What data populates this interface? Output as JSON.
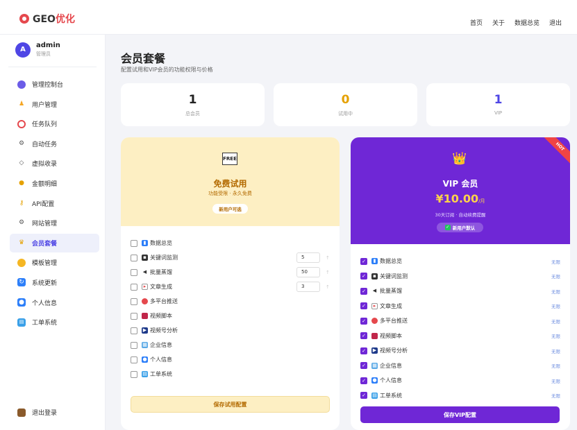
{
  "brand": {
    "logo_text": "GEO",
    "logo_accent": "优化",
    "accent_color": "#e5484d"
  },
  "topnav": {
    "home": "首页",
    "about": "关于",
    "overview": "数据总览",
    "exit": "退出"
  },
  "user": {
    "avatar_letter": "A",
    "name": "admin",
    "role": "管理员"
  },
  "sidebar": {
    "items": [
      {
        "label": "管理控制台",
        "icon": "console-icon"
      },
      {
        "label": "用户管理",
        "icon": "users-icon"
      },
      {
        "label": "任务队列",
        "icon": "queue-icon"
      },
      {
        "label": "自动任务",
        "icon": "auto-task-icon"
      },
      {
        "label": "虚拟收录",
        "icon": "tag-icon"
      },
      {
        "label": "金额明细",
        "icon": "money-icon"
      },
      {
        "label": "API配置",
        "icon": "key-icon"
      },
      {
        "label": "网站管理",
        "icon": "gear-icon"
      },
      {
        "label": "会员套餐",
        "icon": "crown-icon"
      },
      {
        "label": "模板管理",
        "icon": "palette-icon"
      },
      {
        "label": "系统更新",
        "icon": "refresh-icon"
      },
      {
        "label": "个人信息",
        "icon": "profile-icon"
      },
      {
        "label": "工单系统",
        "icon": "ticket-icon"
      }
    ],
    "logout": "退出登录"
  },
  "page": {
    "title": "会员套餐",
    "subtitle": "配置试用和VIP会员的功能权限与价格"
  },
  "stats": [
    {
      "value": "1",
      "label": "总会员",
      "color": "#222222"
    },
    {
      "value": "0",
      "label": "试用中",
      "color": "#e5a100"
    },
    {
      "value": "1",
      "label": "VIP",
      "color": "#4f46e5"
    }
  ],
  "free_plan": {
    "badge": "FREE",
    "title": "免费试用",
    "subtitle": "功能受限 · 永久免费",
    "pill": "新用户可选",
    "features": [
      {
        "label": "数据总览",
        "icon": "chart-icon",
        "checked": false
      },
      {
        "label": "关键词监测",
        "icon": "monitor-icon",
        "checked": false,
        "quota": "5"
      },
      {
        "label": "批量蒸馏",
        "icon": "speaker-icon",
        "checked": false,
        "quota": "50"
      },
      {
        "label": "文章生成",
        "icon": "document-icon",
        "checked": false,
        "quota": "3"
      },
      {
        "label": "多平台推送",
        "icon": "push-icon",
        "checked": false
      },
      {
        "label": "视频脚本",
        "icon": "video-icon",
        "checked": false
      },
      {
        "label": "视频号分析",
        "icon": "play-icon",
        "checked": false
      },
      {
        "label": "企业信息",
        "icon": "building-icon",
        "checked": false
      },
      {
        "label": "个人信息",
        "icon": "profile-icon",
        "checked": false
      },
      {
        "label": "工单系统",
        "icon": "ticket-icon",
        "checked": false
      }
    ],
    "save_label": "保存试用配置"
  },
  "vip_plan": {
    "title": "VIP 会员",
    "price": "¥10.00",
    "price_unit": "/月",
    "subtitle": "30天订阅 · 自动续费提醒",
    "pill": "新用户默认",
    "hot_badge": "HOT",
    "unlimited_label": "无限",
    "features": [
      {
        "label": "数据总览",
        "icon": "chart-icon",
        "checked": true
      },
      {
        "label": "关键词监测",
        "icon": "monitor-icon",
        "checked": true
      },
      {
        "label": "批量蒸馏",
        "icon": "speaker-icon",
        "checked": true
      },
      {
        "label": "文章生成",
        "icon": "document-icon",
        "checked": true
      },
      {
        "label": "多平台推送",
        "icon": "push-icon",
        "checked": true
      },
      {
        "label": "视频脚本",
        "icon": "video-icon",
        "checked": true
      },
      {
        "label": "视频号分析",
        "icon": "play-icon",
        "checked": true
      },
      {
        "label": "企业信息",
        "icon": "building-icon",
        "checked": true
      },
      {
        "label": "个人信息",
        "icon": "profile-icon",
        "checked": true
      },
      {
        "label": "工单系统",
        "icon": "ticket-icon",
        "checked": true
      }
    ],
    "save_label": "保存VIP配置"
  }
}
